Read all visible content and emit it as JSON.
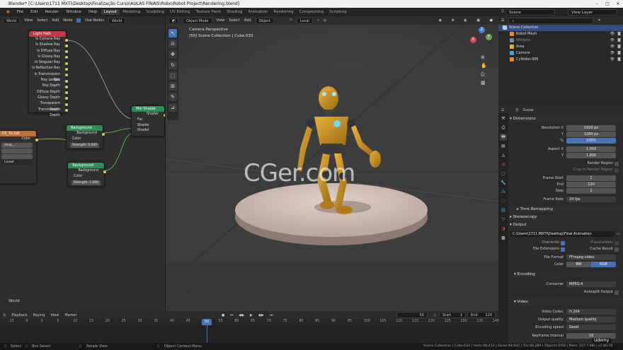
{
  "window": {
    "title": "Blender* [C:\\Users\\1711 MXTI\\Desktop\\Finalização Curso\\AULAS FINAIS\\Robo\\Robot Project\\Rendering.blend]"
  },
  "menu": [
    "File",
    "Edit",
    "Render",
    "Window",
    "Help"
  ],
  "workspaces": [
    "Layout",
    "Modeling",
    "Sculpting",
    "UV Editing",
    "Texture Paint",
    "Shading",
    "Animation",
    "Rendering",
    "Compositing",
    "Scripting"
  ],
  "active_workspace": "Layout",
  "scene_selector": {
    "scene": "Scene",
    "view_layer": "View Layer"
  },
  "node_editor": {
    "header": {
      "world": "World",
      "view": "View",
      "select": "Select",
      "add": "Add",
      "node": "Node",
      "use_nodes": "Use Nodes",
      "world_name": "World"
    },
    "footer_label": "World",
    "light_path": {
      "title": "Light Path",
      "outputs": [
        "Is Camera Ray",
        "Is Shadow Ray",
        "Is Diffuse Ray",
        "Is Glossy Ray",
        "Is Singular Ray",
        "Is Reflection Ray",
        "Is Transmission Ray",
        "Ray Length",
        "Ray Depth",
        "Diffuse Depth",
        "Glossy Depth",
        "Transparent Depth",
        "Transmission Depth"
      ]
    },
    "image_node": {
      "title": "03_1k.hdr",
      "color": "Color",
      "field1": "shop_...",
      "field2": "",
      "field3": "",
      "field4": "Linear"
    },
    "background1": {
      "title": "Background",
      "output": "Background",
      "color": "Color",
      "strength": "Strength: 0.500"
    },
    "background2": {
      "title": "Background",
      "output": "Background",
      "color": "Color",
      "strength": "Strength: 1.000"
    },
    "mix_shader": {
      "title": "Mix Shader",
      "output": "Shader",
      "fac": "Fac",
      "shader1": "Shader",
      "shader2": "Shader"
    }
  },
  "viewport": {
    "header": {
      "mode": "Object Mode",
      "view": "View",
      "select": "Select",
      "add": "Add",
      "object": "Object",
      "orientation": "Local"
    },
    "overlay_title": "Camera Perspective",
    "overlay_sub": "(50) Scene Collection | Cube.033",
    "watermark": "CGer.com",
    "gizmo": {
      "z": "Z",
      "y": "Y",
      "x": "X"
    }
  },
  "outliner": {
    "search_placeholder": "",
    "rows": [
      {
        "label": "Scene Collection",
        "color": "#cccccc",
        "selected": true
      },
      {
        "label": "Robot Mesh",
        "color": "#e08a3c",
        "selected": false
      },
      {
        "label": "Widgets",
        "color": "#888888",
        "selected": false
      },
      {
        "label": "Area",
        "color": "#e0b03c",
        "selected": false
      },
      {
        "label": "Camera",
        "color": "#4fa0d8",
        "selected": false
      },
      {
        "label": "Cylinder.006",
        "color": "#e08a3c",
        "selected": false
      }
    ]
  },
  "properties": {
    "scene_label": "Scene",
    "dimensions": "Dimensions",
    "resolution_x_label": "Resolution X",
    "resolution_x": "1920 px",
    "y_label": "Y",
    "resolution_y": "1080 px",
    "pct_label": "%",
    "pct": "100%",
    "aspect_x_label": "Aspect X",
    "aspect_x": "1.000",
    "aspect_y": "1.000",
    "render_region": "Render Region",
    "crop_region": "Crop to Render Region",
    "frame_start_label": "Frame Start",
    "frame_start": "1",
    "end_label": "End",
    "end": "120",
    "step_label": "Step",
    "step": "1",
    "frame_rate_label": "Frame Rate",
    "frame_rate": "24 fps",
    "time_remapping": "Time Remapping",
    "stereoscopy": "Stereoscopy",
    "output": "Output",
    "output_path": "C:\\Users\\1711 MXTI\\Desktop\\Final Animation",
    "overwrite": "Overwrite",
    "placeholders": "Placeholders",
    "file_ext": "File Extensions",
    "cache_result": "Cache Result",
    "file_format_label": "File Format",
    "file_format": "FFmpeg video",
    "color_label": "Color",
    "bw": "BW",
    "rgb": "RGB",
    "encoding": "Encoding",
    "container_label": "Container",
    "container": "MPEG-4",
    "autosplit": "Autosplit Output",
    "video": "Video",
    "video_codec_label": "Video Codec",
    "video_codec": "H.264",
    "output_quality_label": "Output quality",
    "output_quality": "Medium quality",
    "encoding_speed_label": "Encoding speed",
    "encoding_speed": "Good",
    "keyframe_label": "Keyframe interval",
    "keyframe": "18"
  },
  "timeline": {
    "menu": [
      "Playback",
      "Keying",
      "View",
      "Marker"
    ],
    "current_frame": "50",
    "start_label": "Start",
    "start": "1",
    "end_label": "End",
    "end": "120",
    "ticks": [
      "-15",
      "-5",
      "0",
      "5",
      "10",
      "15",
      "20",
      "25",
      "30",
      "35",
      "40",
      "45",
      "50",
      "55",
      "60",
      "65",
      "70",
      "75",
      "80",
      "85",
      "90",
      "95",
      "100",
      "105",
      "110",
      "115",
      "120",
      "125",
      "130",
      "135",
      "140"
    ]
  },
  "statusbar": {
    "select": "Select",
    "box_select": "Box Select",
    "rotate": "Rotate View",
    "context": "Object Context Menu",
    "stats": "Scene Collection | Cube.033 | Verts:48,412 | Faces:48,942 | Tris:96,380 | Objects:0/50 | Mem: 107.7 MB | v2.80.74"
  },
  "udemy": "Udemy"
}
